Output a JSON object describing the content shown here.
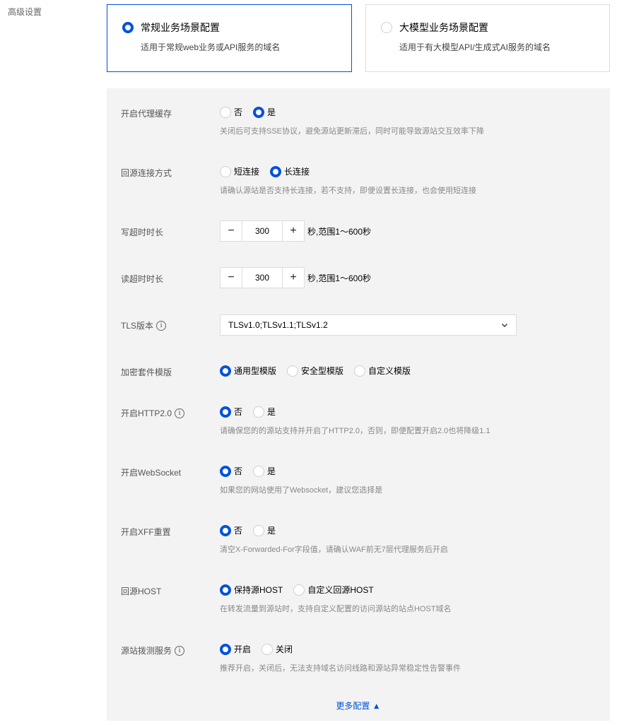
{
  "section": {
    "label": "高级设置"
  },
  "scenario_cards": [
    {
      "title": "常规业务场景配置",
      "desc": "适用于常规web业务或API服务的域名",
      "selected": true
    },
    {
      "title": "大模型业务场景配置",
      "desc": "适用于有大模型API/生成式AI服务的域名",
      "selected": false
    }
  ],
  "proxy_cache": {
    "label": "开启代理缓存",
    "options": [
      "否",
      "是"
    ],
    "selected": "是",
    "hint": "关闭后可支持SSE协议，避免源站更新滞后，同时可能导致源站交互效率下降"
  },
  "origin_conn": {
    "label": "回源连接方式",
    "options": [
      "短连接",
      "长连接"
    ],
    "selected": "长连接",
    "hint": "请确认源站是否支持长连接，若不支持，即便设置长连接，也会使用短连接"
  },
  "write_timeout": {
    "label": "写超时时长",
    "minus": "−",
    "value": "300",
    "plus": "+",
    "unit": "秒,范围1～600秒"
  },
  "read_timeout": {
    "label": "读超时时长",
    "minus": "−",
    "value": "300",
    "plus": "+",
    "unit": "秒,范围1～600秒"
  },
  "tls": {
    "label": "TLS版本",
    "value": "TLSv1.0;TLSv1.1;TLSv1.2",
    "info_icon": "i"
  },
  "cipher": {
    "label": "加密套件模版",
    "options": [
      "通用型模版",
      "安全型模版",
      "自定义模版"
    ],
    "selected": "通用型模版"
  },
  "http2": {
    "label": "开启HTTP2.0",
    "info_icon": "i",
    "options": [
      "否",
      "是"
    ],
    "selected": "否",
    "hint": "请确保您的的源站支持并开启了HTTP2.0，否则，即便配置开启2.0也将降级1.1"
  },
  "websocket": {
    "label": "开启WebSocket",
    "options": [
      "否",
      "是"
    ],
    "selected": "否",
    "hint": "如果您的网站使用了Websocket，建议您选择是"
  },
  "xff": {
    "label": "开启XFF重置",
    "options": [
      "否",
      "是"
    ],
    "selected": "否",
    "hint": "清空X-Forwarded-For字段值，请确认WAF前无7层代理服务后开启"
  },
  "origin_host": {
    "label": "回源HOST",
    "options": [
      "保持源HOST",
      "自定义回源HOST"
    ],
    "selected": "保持源HOST",
    "hint": "在转发流量到源站时，支持自定义配置的访问源站的站点HOST域名"
  },
  "probe": {
    "label": "源站拨测服务",
    "info_icon": "i",
    "options": [
      "开启",
      "关闭"
    ],
    "selected": "开启",
    "hint": "推荐开启，关闭后，无法支持域名访问线路和源站异常稳定性告警事件"
  },
  "more": {
    "label": "更多配置 ▲"
  },
  "colors": {
    "accent": "#0052d9",
    "panel_bg": "#f3f3f3"
  }
}
